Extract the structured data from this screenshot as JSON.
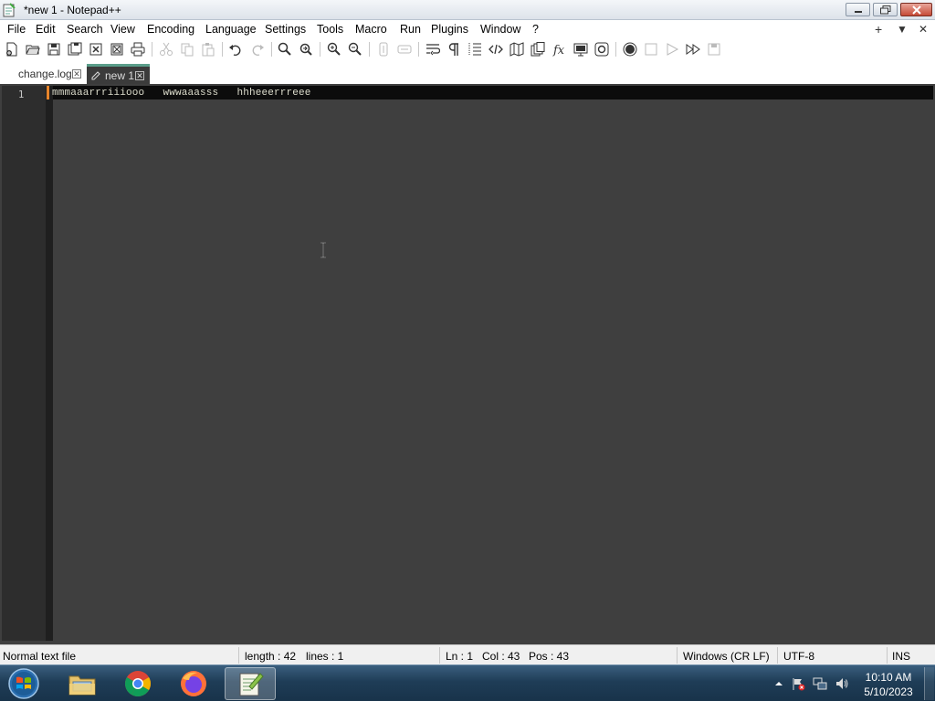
{
  "window": {
    "title": "*new 1 - Notepad++"
  },
  "menu": {
    "items": [
      "File",
      "Edit",
      "Search",
      "View",
      "Encoding",
      "Language",
      "Settings",
      "Tools",
      "Macro",
      "Run",
      "Plugins",
      "Window",
      "?"
    ],
    "right": [
      "+",
      "▼",
      "✕"
    ]
  },
  "toolbar": {
    "icons": [
      "new-file-icon",
      "open-file-icon",
      "save-icon",
      "save-all-icon",
      "close-icon",
      "close-all-icon",
      "print-icon",
      "cut-icon",
      "copy-icon",
      "paste-icon",
      "undo-icon",
      "redo-icon",
      "find-icon",
      "replace-icon",
      "zoom-in-icon",
      "zoom-out-icon",
      "sync-vertical-icon",
      "sync-horizontal-icon",
      "word-wrap-icon",
      "show-all-characters-icon",
      "indent-guide-icon",
      "xml-tag-icon",
      "document-map-icon",
      "document-list-icon",
      "function-list-icon",
      "folder-workspace-icon",
      "monitoring-icon",
      "record-macro-icon",
      "stop-macro-icon",
      "play-macro-icon",
      "run-macro-multiple-icon",
      "save-macro-icon"
    ]
  },
  "tabs": [
    {
      "label": "change.log",
      "active": false
    },
    {
      "label": "new 1",
      "active": true
    }
  ],
  "editor": {
    "line_number": "1",
    "line_text": "mmmaaarrriiiooo   wwwaaasss   hhheeerrreee",
    "background": "#3f3f3f",
    "current_line_bg": "#0c0c0c",
    "change_marker": "#e8852a"
  },
  "status": {
    "file_type": "Normal text file",
    "length": "length : 42",
    "lines": "lines : 1",
    "ln": "Ln : 1",
    "col": "Col : 43",
    "pos": "Pos : 43",
    "eol": "Windows (CR LF)",
    "encoding": "UTF-8",
    "mode": "INS"
  },
  "taskbar": {
    "apps": [
      "file-explorer",
      "chrome",
      "firefox",
      "notepad++"
    ],
    "time": "10:10 AM",
    "date": "5/10/2023"
  }
}
